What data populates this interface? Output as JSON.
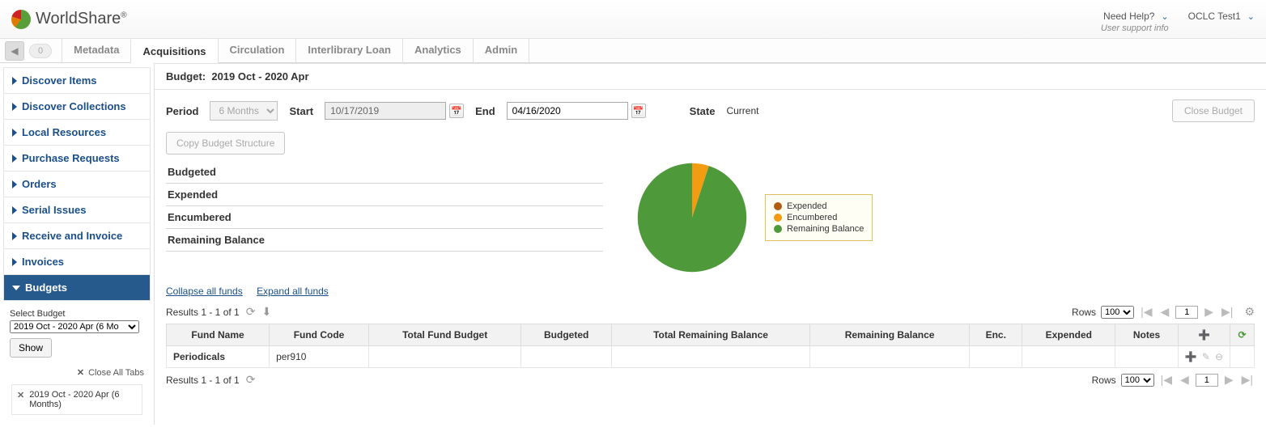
{
  "header": {
    "brand": "WorldShare",
    "brand_mark": "®",
    "need_help": "Need Help?",
    "support_info": "User support info",
    "user": "OCLC Test1",
    "history_count": "0"
  },
  "tabs": {
    "items": [
      "Metadata",
      "Acquisitions",
      "Circulation",
      "Interlibrary Loan",
      "Analytics",
      "Admin"
    ],
    "active_index": 1
  },
  "sidebar": {
    "items": [
      "Discover Items",
      "Discover Collections",
      "Local Resources",
      "Purchase Requests",
      "Orders",
      "Serial Issues",
      "Receive and Invoice",
      "Invoices",
      "Budgets"
    ],
    "active_index": 8,
    "select_budget_label": "Select Budget",
    "select_budget_value": "2019 Oct - 2020 Apr (6 Mo",
    "show_button": "Show",
    "close_all_tabs": "Close All Tabs",
    "open_tab": "2019 Oct - 2020 Apr (6 Months)"
  },
  "budget": {
    "title_label": "Budget:",
    "title_value": "2019 Oct - 2020 Apr",
    "period_label": "Period",
    "period_value": "6 Months",
    "start_label": "Start",
    "start_value": "10/17/2019",
    "end_label": "End",
    "end_value": "04/16/2020",
    "state_label": "State",
    "state_value": "Current",
    "close_budget": "Close Budget",
    "copy_structure": "Copy Budget Structure"
  },
  "summary": {
    "rows": [
      "Budgeted",
      "Expended",
      "Encumbered",
      "Remaining Balance"
    ]
  },
  "legend": {
    "expended": "Expended",
    "encumbered": "Encumbered",
    "remaining": "Remaining Balance",
    "colors": {
      "expended": "#b05c13",
      "encumbered": "#f39c12",
      "remaining": "#4e9a3a"
    }
  },
  "chart_data": {
    "type": "pie",
    "title": "",
    "series": [
      {
        "name": "Expended",
        "value": 0,
        "color": "#b05c13"
      },
      {
        "name": "Encumbered",
        "value": 5,
        "color": "#f39c12"
      },
      {
        "name": "Remaining Balance",
        "value": 95,
        "color": "#4e9a3a"
      }
    ]
  },
  "links": {
    "collapse": "Collapse all funds",
    "expand": "Expand all funds"
  },
  "results": {
    "text": "Results 1 - 1 of 1",
    "rows_label": "Rows",
    "rows_value": "100",
    "page": "1"
  },
  "table": {
    "headers": [
      "Fund Name",
      "Fund Code",
      "Total Fund Budget",
      "Budgeted",
      "Total Remaining Balance",
      "Remaining Balance",
      "Enc.",
      "Expended",
      "Notes"
    ],
    "rows": [
      {
        "fund_name": "Periodicals",
        "fund_code": "per910",
        "total_fund_budget": "",
        "budgeted": "",
        "total_remaining_balance": "",
        "remaining_balance": "",
        "enc": "",
        "expended": "",
        "notes": ""
      }
    ]
  }
}
